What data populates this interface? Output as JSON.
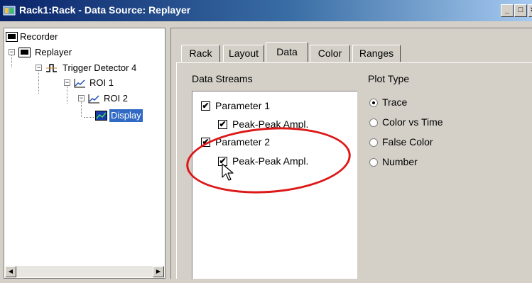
{
  "window": {
    "title": "Rack1:Rack - Data Source: Replayer",
    "minimize_label": "_",
    "maximize_label": "□",
    "close_label": "×"
  },
  "tree": {
    "items": [
      {
        "label": "Recorder",
        "icon": "recorder-icon"
      },
      {
        "label": "Replayer",
        "icon": "recorder-icon"
      },
      {
        "label": "Trigger Detector 4",
        "icon": "trigger-icon"
      },
      {
        "label": "ROI 1",
        "icon": "roi-icon"
      },
      {
        "label": "ROI 2",
        "icon": "roi-icon"
      },
      {
        "label": "Display",
        "icon": "display-icon"
      }
    ],
    "expander_symbol": "−"
  },
  "scrollbar": {
    "left_arrow": "◀",
    "right_arrow": "▶"
  },
  "tabs": [
    {
      "label": "Rack"
    },
    {
      "label": "Layout"
    },
    {
      "label": "Data",
      "active": true
    },
    {
      "label": "Color"
    },
    {
      "label": "Ranges"
    }
  ],
  "data_streams": {
    "label": "Data Streams",
    "items": [
      {
        "label": "Parameter 1",
        "checked": true
      },
      {
        "label": "Peak-Peak Ampl.",
        "checked": true
      },
      {
        "label": "Parameter 2",
        "checked": true
      },
      {
        "label": "Peak-Peak Ampl.",
        "checked": true
      }
    ],
    "check_mark": "✔"
  },
  "plot_type": {
    "label": "Plot Type",
    "options": [
      {
        "label": "Trace",
        "checked": true
      },
      {
        "label": "Color vs Time",
        "checked": false
      },
      {
        "label": "False Color",
        "checked": false
      },
      {
        "label": "Number",
        "checked": false
      }
    ]
  },
  "colors": {
    "title_bar_start": "#0a246a",
    "title_bar_end": "#a6caf0",
    "selection": "#316ac5",
    "highlight_ellipse": "#dd1818",
    "window_face": "#d4d0c8"
  }
}
